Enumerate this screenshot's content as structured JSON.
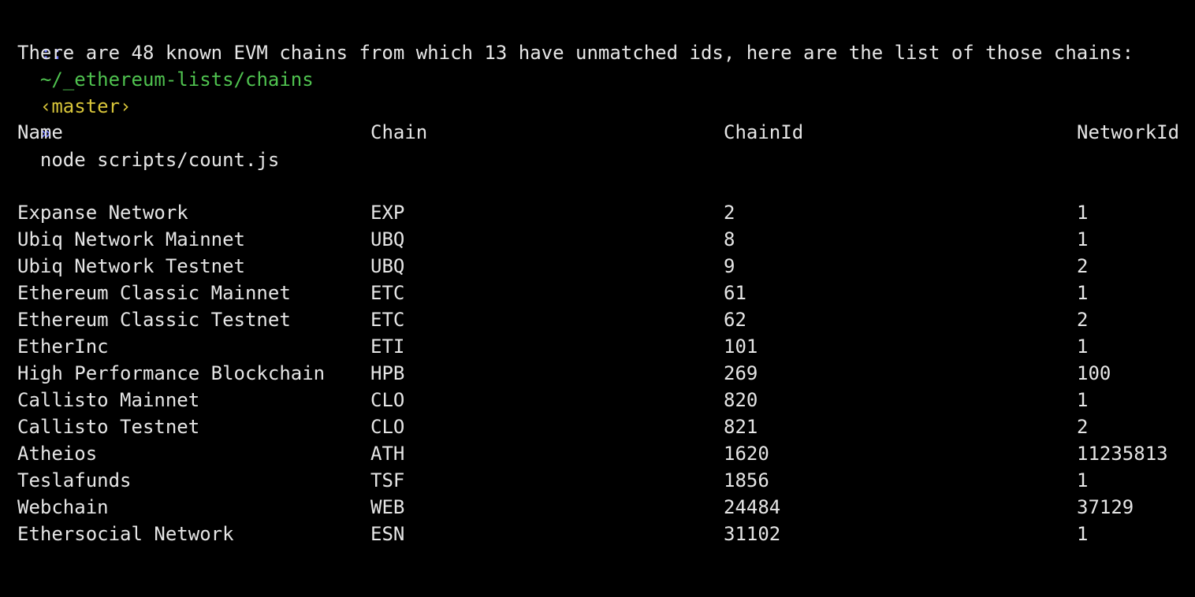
{
  "terminal": {
    "colors": {
      "background": "#000000",
      "text": "#e6e6e6",
      "prompt_marker": "#6f79ff",
      "path": "#4fc24f",
      "branch": "#d8c53a"
    },
    "prompt": {
      "marker": "::",
      "path": "~/_ethereum-lists/chains",
      "branch": "‹master›",
      "arrow": "»",
      "command": "node scripts/count.js"
    },
    "summary": "There are 48 known EVM chains from which 13 have unmatched ids, here are the list of those chains:",
    "table": {
      "headers": [
        "Name",
        "Chain",
        "ChainId",
        "NetworkId"
      ],
      "rows": [
        [
          "Expanse Network",
          "EXP",
          "2",
          "1"
        ],
        [
          "Ubiq Network Mainnet",
          "UBQ",
          "8",
          "1"
        ],
        [
          "Ubiq Network Testnet",
          "UBQ",
          "9",
          "2"
        ],
        [
          "Ethereum Classic Mainnet",
          "ETC",
          "61",
          "1"
        ],
        [
          "Ethereum Classic Testnet",
          "ETC",
          "62",
          "2"
        ],
        [
          "EtherInc",
          "ETI",
          "101",
          "1"
        ],
        [
          "High Performance Blockchain",
          "HPB",
          "269",
          "100"
        ],
        [
          "Callisto Mainnet",
          "CLO",
          "820",
          "1"
        ],
        [
          "Callisto Testnet",
          "CLO",
          "821",
          "2"
        ],
        [
          "Atheios",
          "ATH",
          "1620",
          "11235813"
        ],
        [
          "Teslafunds",
          "TSF",
          "1856",
          "1"
        ],
        [
          "Webchain",
          "WEB",
          "24484",
          "37129"
        ],
        [
          "Ethersocial Network",
          "ESN",
          "31102",
          "1"
        ]
      ]
    }
  }
}
